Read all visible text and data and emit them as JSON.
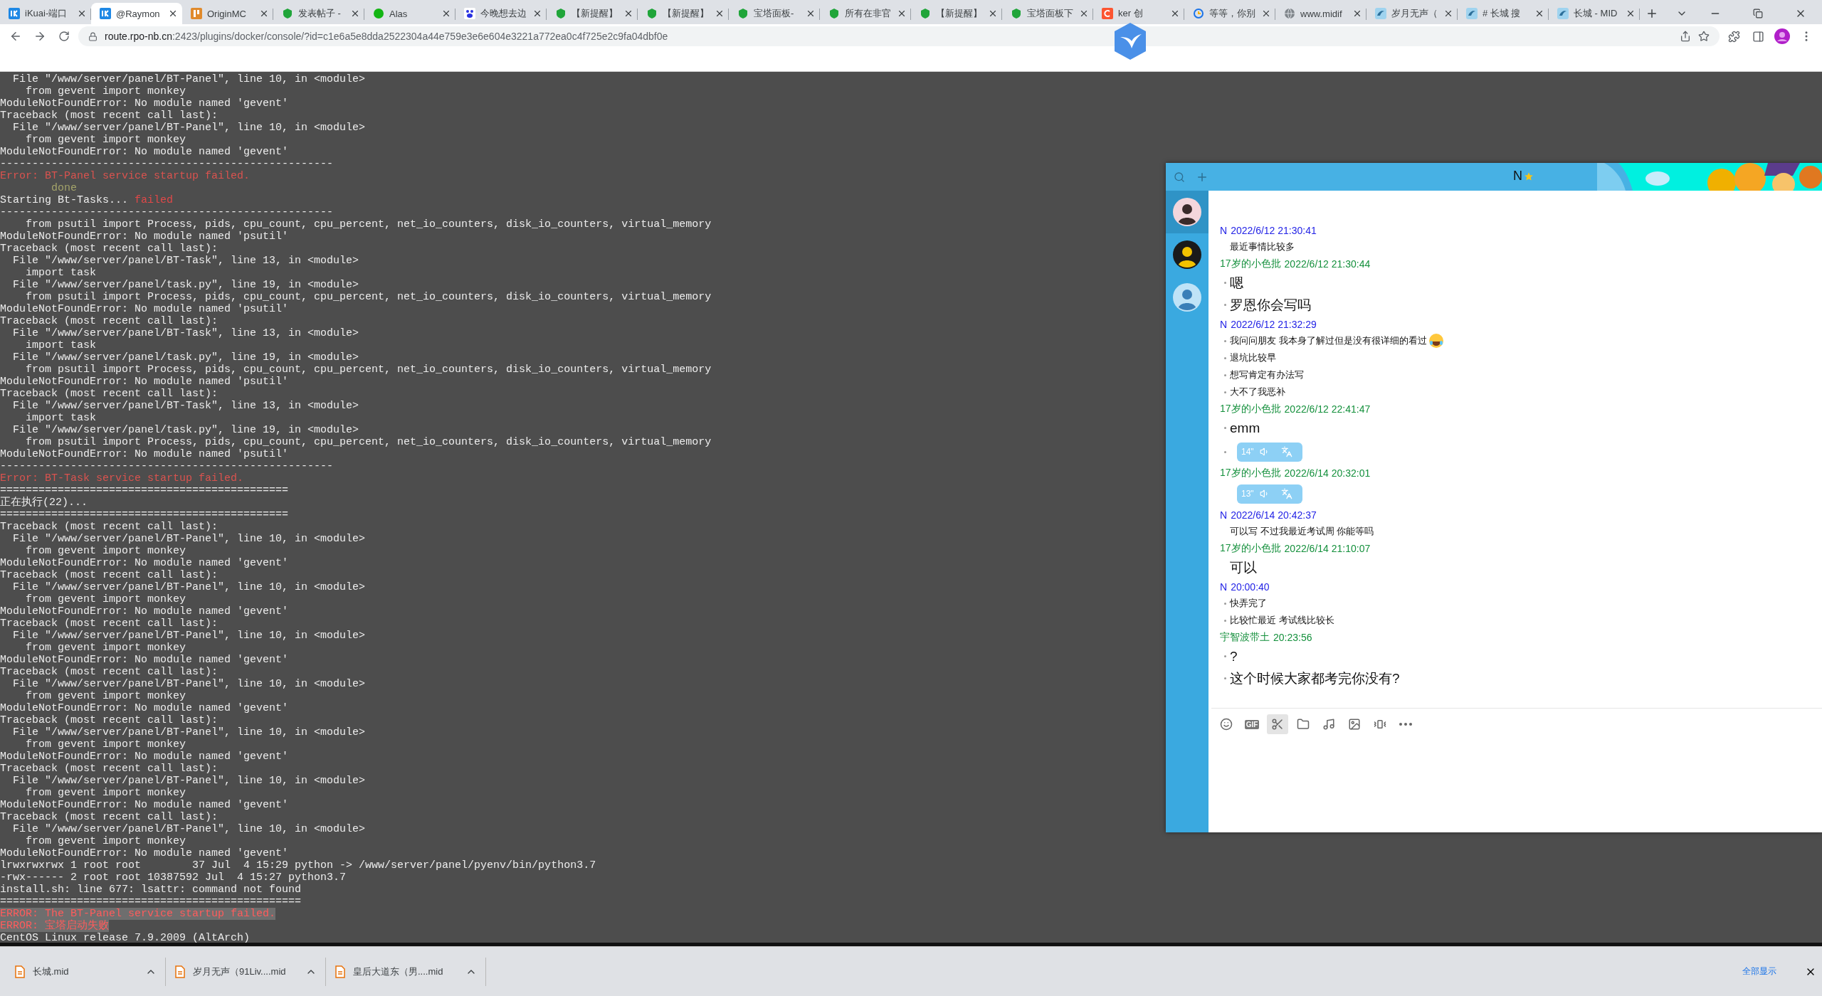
{
  "tabs": [
    {
      "title": "iKuai-端口",
      "kind": "kblock",
      "selected": false
    },
    {
      "title": "@Raymon",
      "kind": "kblock",
      "selected": true
    },
    {
      "title": "OriginMC",
      "kind": "bars",
      "selected": false
    },
    {
      "title": "发表帖子 -",
      "kind": "shield",
      "selected": false
    },
    {
      "title": "Alas",
      "kind": "dot",
      "selected": false
    },
    {
      "title": "今晚想去边",
      "kind": "paw",
      "selected": false
    },
    {
      "title": "【新提醒】",
      "kind": "shield",
      "selected": false
    },
    {
      "title": "【新提醒】",
      "kind": "shield",
      "selected": false
    },
    {
      "title": "宝塔面板-",
      "kind": "shield",
      "selected": false
    },
    {
      "title": "所有在非官",
      "kind": "shield",
      "selected": false
    },
    {
      "title": "【新提醒】",
      "kind": "shield",
      "selected": false
    },
    {
      "title": "宝塔面板下",
      "kind": "shield",
      "selected": false
    },
    {
      "title": "ker 创",
      "kind": "arc",
      "selected": false
    },
    {
      "title": "等等，你别",
      "kind": "ring",
      "selected": false
    },
    {
      "title": "www.midif",
      "kind": "globe",
      "selected": false
    },
    {
      "title": "岁月无声（",
      "kind": "bird",
      "selected": false
    },
    {
      "title": "# 长城 搜",
      "kind": "bird",
      "selected": false
    },
    {
      "title": "长城 - MID",
      "kind": "bird",
      "selected": false
    }
  ],
  "address": {
    "host": "route.rpo-nb.cn",
    "path": ":2423/plugins/docker/console/?id=c1e6a5e8dda2522304a44e759e3e6e604e3221a772ea0c4f725e2c9fa04dbf0e"
  },
  "terminal": {
    "lines": [
      {
        "kind": "out",
        "text": "  File \"/www/server/panel/BT-Panel\", line 10, in <module>"
      },
      {
        "kind": "out",
        "text": "    from gevent import monkey"
      },
      {
        "kind": "out",
        "text": "ModuleNotFoundError: No module named 'gevent'"
      },
      {
        "kind": "out",
        "text": "Traceback (most recent call last):"
      },
      {
        "kind": "out",
        "text": "  File \"/www/server/panel/BT-Panel\", line 10, in <module>"
      },
      {
        "kind": "out",
        "text": "    from gevent import monkey"
      },
      {
        "kind": "out",
        "text": "ModuleNotFoundError: No module named 'gevent'"
      },
      {
        "kind": "out",
        "text": "----------------------------------------------------"
      },
      {
        "kind": "error",
        "text": "Error: BT-Panel service startup failed."
      },
      {
        "kind": "done",
        "text": "        done"
      },
      {
        "kind": "status",
        "text": "Starting Bt-Tasks...",
        "status": "failed"
      },
      {
        "kind": "out",
        "text": "----------------------------------------------------"
      },
      {
        "kind": "out",
        "text": "    from psutil import Process, pids, cpu_count, cpu_percent, net_io_counters, disk_io_counters, virtual_memory"
      },
      {
        "kind": "out",
        "text": "ModuleNotFoundError: No module named 'psutil'"
      },
      {
        "kind": "out",
        "text": "Traceback (most recent call last):"
      },
      {
        "kind": "out",
        "text": "  File \"/www/server/panel/BT-Task\", line 13, in <module>"
      },
      {
        "kind": "out",
        "text": "    import task"
      },
      {
        "kind": "out",
        "text": "  File \"/www/server/panel/task.py\", line 19, in <module>"
      },
      {
        "kind": "out",
        "text": "    from psutil import Process, pids, cpu_count, cpu_percent, net_io_counters, disk_io_counters, virtual_memory"
      },
      {
        "kind": "out",
        "text": "ModuleNotFoundError: No module named 'psutil'"
      },
      {
        "kind": "out",
        "text": "Traceback (most recent call last):"
      },
      {
        "kind": "out",
        "text": "  File \"/www/server/panel/BT-Task\", line 13, in <module>"
      },
      {
        "kind": "out",
        "text": "    import task"
      },
      {
        "kind": "out",
        "text": "  File \"/www/server/panel/task.py\", line 19, in <module>"
      },
      {
        "kind": "out",
        "text": "    from psutil import Process, pids, cpu_count, cpu_percent, net_io_counters, disk_io_counters, virtual_memory"
      },
      {
        "kind": "out",
        "text": "ModuleNotFoundError: No module named 'psutil'"
      },
      {
        "kind": "out",
        "text": "Traceback (most recent call last):"
      },
      {
        "kind": "out",
        "text": "  File \"/www/server/panel/BT-Task\", line 13, in <module>"
      },
      {
        "kind": "out",
        "text": "    import task"
      },
      {
        "kind": "out",
        "text": "  File \"/www/server/panel/task.py\", line 19, in <module>"
      },
      {
        "kind": "out",
        "text": "    from psutil import Process, pids, cpu_count, cpu_percent, net_io_counters, disk_io_counters, virtual_memory"
      },
      {
        "kind": "out",
        "text": "ModuleNotFoundError: No module named 'psutil'"
      },
      {
        "kind": "out",
        "text": "----------------------------------------------------"
      },
      {
        "kind": "error",
        "text": "Error: BT-Task service startup failed."
      },
      {
        "kind": "out",
        "text": "============================================="
      },
      {
        "kind": "out",
        "text": "正在执行(22)..."
      },
      {
        "kind": "out",
        "text": "============================================="
      },
      {
        "kind": "out",
        "text": "Traceback (most recent call last):"
      },
      {
        "kind": "out",
        "text": "  File \"/www/server/panel/BT-Panel\", line 10, in <module>"
      },
      {
        "kind": "out",
        "text": "    from gevent import monkey"
      },
      {
        "kind": "out",
        "text": "ModuleNotFoundError: No module named 'gevent'"
      },
      {
        "kind": "out",
        "text": "Traceback (most recent call last):"
      },
      {
        "kind": "out",
        "text": "  File \"/www/server/panel/BT-Panel\", line 10, in <module>"
      },
      {
        "kind": "out",
        "text": "    from gevent import monkey"
      },
      {
        "kind": "out",
        "text": "ModuleNotFoundError: No module named 'gevent'"
      },
      {
        "kind": "out",
        "text": "Traceback (most recent call last):"
      },
      {
        "kind": "out",
        "text": "  File \"/www/server/panel/BT-Panel\", line 10, in <module>"
      },
      {
        "kind": "out",
        "text": "    from gevent import monkey"
      },
      {
        "kind": "out",
        "text": "ModuleNotFoundError: No module named 'gevent'"
      },
      {
        "kind": "out",
        "text": "Traceback (most recent call last):"
      },
      {
        "kind": "out",
        "text": "  File \"/www/server/panel/BT-Panel\", line 10, in <module>"
      },
      {
        "kind": "out",
        "text": "    from gevent import monkey"
      },
      {
        "kind": "out",
        "text": "ModuleNotFoundError: No module named 'gevent'"
      },
      {
        "kind": "out",
        "text": "Traceback (most recent call last):"
      },
      {
        "kind": "out",
        "text": "  File \"/www/server/panel/BT-Panel\", line 10, in <module>"
      },
      {
        "kind": "out",
        "text": "    from gevent import monkey"
      },
      {
        "kind": "out",
        "text": "ModuleNotFoundError: No module named 'gevent'"
      },
      {
        "kind": "out",
        "text": "Traceback (most recent call last):"
      },
      {
        "kind": "out",
        "text": "  File \"/www/server/panel/BT-Panel\", line 10, in <module>"
      },
      {
        "kind": "out",
        "text": "    from gevent import monkey"
      },
      {
        "kind": "out",
        "text": "ModuleNotFoundError: No module named 'gevent'"
      },
      {
        "kind": "out",
        "text": "Traceback (most recent call last):"
      },
      {
        "kind": "out",
        "text": "  File \"/www/server/panel/BT-Panel\", line 10, in <module>"
      },
      {
        "kind": "out",
        "text": "    from gevent import monkey"
      },
      {
        "kind": "out",
        "text": "ModuleNotFoundError: No module named 'gevent'"
      },
      {
        "kind": "out",
        "text": "lrwxrwxrwx 1 root root        37 Jul  4 15:29 python -> /www/server/panel/pyenv/bin/python3.7"
      },
      {
        "kind": "out",
        "text": "-rwx------ 2 root root 10387592 Jul  4 15:27 python3.7"
      },
      {
        "kind": "out",
        "text": "install.sh: line 677: lsattr: command not found"
      },
      {
        "kind": "out",
        "text": "==============================================="
      },
      {
        "kind": "alert",
        "text": "ERROR: The BT-Panel service startup failed."
      },
      {
        "kind": "alert",
        "text": "ERROR: 宝塔启动失败"
      },
      {
        "kind": "out",
        "text": "CentOS Linux release 7.9.2009 (AltArch)"
      }
    ]
  },
  "chat": {
    "title": "N",
    "contacts": [
      {
        "selected": true
      },
      {
        "selected": false
      },
      {
        "selected": false
      }
    ],
    "messages": [
      {
        "sender": "N",
        "time": "2022/6/12 21:30:41",
        "color": "#2323e6",
        "items": [
          {
            "kind": "small",
            "text": "最近事情比较多"
          }
        ]
      },
      {
        "sender": "17岁的小色批",
        "time": "2022/6/12 21:30:44",
        "color": "#14903c",
        "items": [
          {
            "kind": "large",
            "text": "嗯"
          },
          {
            "kind": "large",
            "text": "罗恩你会写吗"
          }
        ]
      },
      {
        "sender": "N",
        "time": "2022/6/12 21:32:29",
        "color": "#2323e6",
        "items": [
          {
            "kind": "small",
            "text": "我问问朋友 我本身了解过但是没有很详细的看过",
            "emoji": true
          },
          {
            "kind": "small",
            "text": "退坑比较早"
          },
          {
            "kind": "small",
            "text": "想写肯定有办法写"
          },
          {
            "kind": "small",
            "text": "大不了我恶补"
          }
        ]
      },
      {
        "sender": "17岁的小色批",
        "time": "2022/6/12 22:41:47",
        "color": "#14903c",
        "items": [
          {
            "kind": "large",
            "text": "emm"
          },
          {
            "kind": "voice",
            "text": "14\""
          }
        ]
      },
      {
        "sender": "17岁的小色批",
        "time": "2022/6/14 20:32:01",
        "color": "#14903c",
        "items": [
          {
            "kind": "voice",
            "text": "13\""
          }
        ]
      },
      {
        "sender": "N",
        "time": "2022/6/14 20:42:37",
        "color": "#2323e6",
        "items": [
          {
            "kind": "small",
            "text": "可以写 不过我最近考试周 你能等吗"
          }
        ]
      },
      {
        "sender": "17岁的小色批",
        "time": "2022/6/14 21:10:07",
        "color": "#14903c",
        "items": [
          {
            "kind": "large",
            "text": "可以"
          }
        ]
      },
      {
        "sender": "N",
        "time": "20:00:40",
        "color": "#2323e6",
        "items": [
          {
            "kind": "small",
            "text": "快弄完了"
          },
          {
            "kind": "small",
            "text": "比较忙最近 考试线比较长"
          }
        ]
      },
      {
        "sender": "宇智波带土",
        "time": "20:23:56",
        "color": "#14903c",
        "items": [
          {
            "kind": "large",
            "text": "?"
          },
          {
            "kind": "large",
            "text": "这个时候大家都考完你没有?"
          }
        ]
      }
    ],
    "toolbar": {
      "gif_label": "GIF",
      "tools": [
        {
          "selected": false
        },
        {
          "selected": false
        },
        {
          "selected": true
        },
        {
          "selected": false
        },
        {
          "selected": false
        },
        {
          "selected": false
        },
        {
          "selected": false
        },
        {
          "selected": false
        }
      ]
    }
  },
  "downloads": {
    "items": [
      {
        "name": "长城.mid"
      },
      {
        "name": "岁月无声（91Liv....mid"
      },
      {
        "name": "皇后大道东（男....mid"
      }
    ],
    "show_all": "全部显示"
  }
}
